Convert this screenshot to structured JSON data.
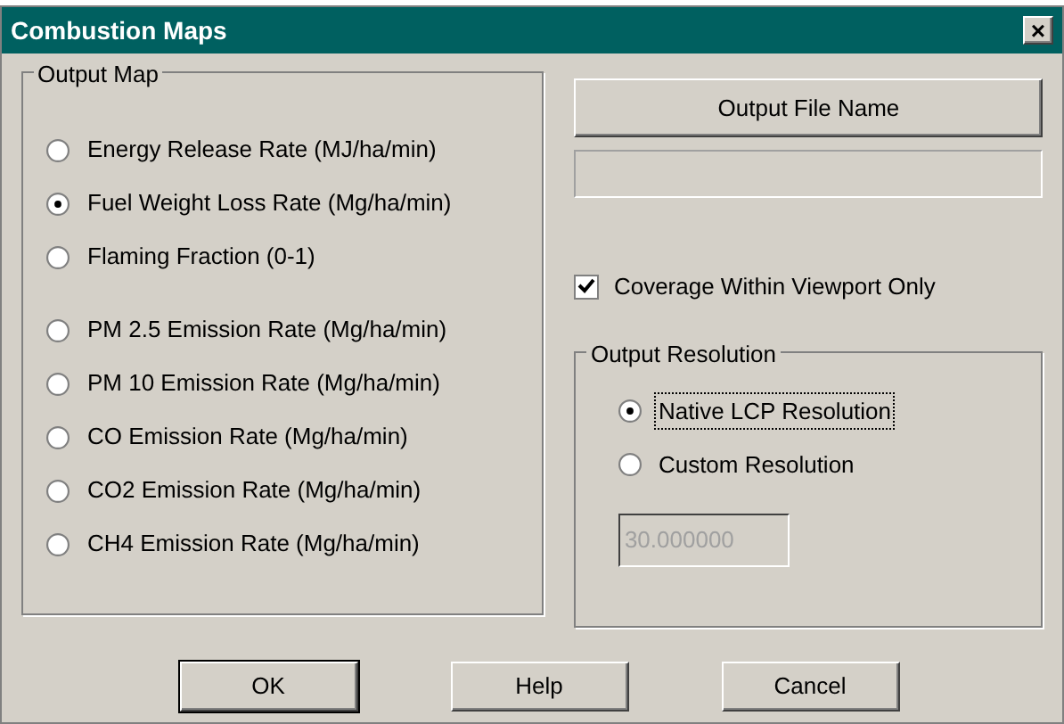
{
  "window": {
    "title": "Combustion Maps",
    "close": "×"
  },
  "output_map": {
    "title": "Output Map",
    "options": [
      {
        "label": "Energy Release Rate (MJ/ha/min)",
        "selected": false,
        "spaced": false
      },
      {
        "label": "Fuel Weight Loss Rate (Mg/ha/min)",
        "selected": true,
        "spaced": false
      },
      {
        "label": "Flaming Fraction (0-1)",
        "selected": false,
        "spaced": false
      },
      {
        "label": "PM 2.5 Emission Rate (Mg/ha/min)",
        "selected": false,
        "spaced": true
      },
      {
        "label": "PM 10 Emission Rate (Mg/ha/min)",
        "selected": false,
        "spaced": false
      },
      {
        "label": "CO Emission Rate (Mg/ha/min)",
        "selected": false,
        "spaced": false
      },
      {
        "label": "CO2 Emission Rate (Mg/ha/min)",
        "selected": false,
        "spaced": false
      },
      {
        "label": "CH4 Emission Rate (Mg/ha/min)",
        "selected": false,
        "spaced": false
      }
    ]
  },
  "output_file_button": "Output File Name",
  "coverage_checkbox": {
    "label": "Coverage Within Viewport Only",
    "checked": true
  },
  "output_resolution": {
    "title": "Output Resolution",
    "options": [
      {
        "label": "Native LCP Resolution",
        "selected": true
      },
      {
        "label": "Custom Resolution",
        "selected": false
      }
    ],
    "value": "30.000000",
    "disabled": true
  },
  "buttons": [
    {
      "label": "OK",
      "default": true
    },
    {
      "label": "Help",
      "default": false
    },
    {
      "label": "Cancel",
      "default": false
    }
  ]
}
